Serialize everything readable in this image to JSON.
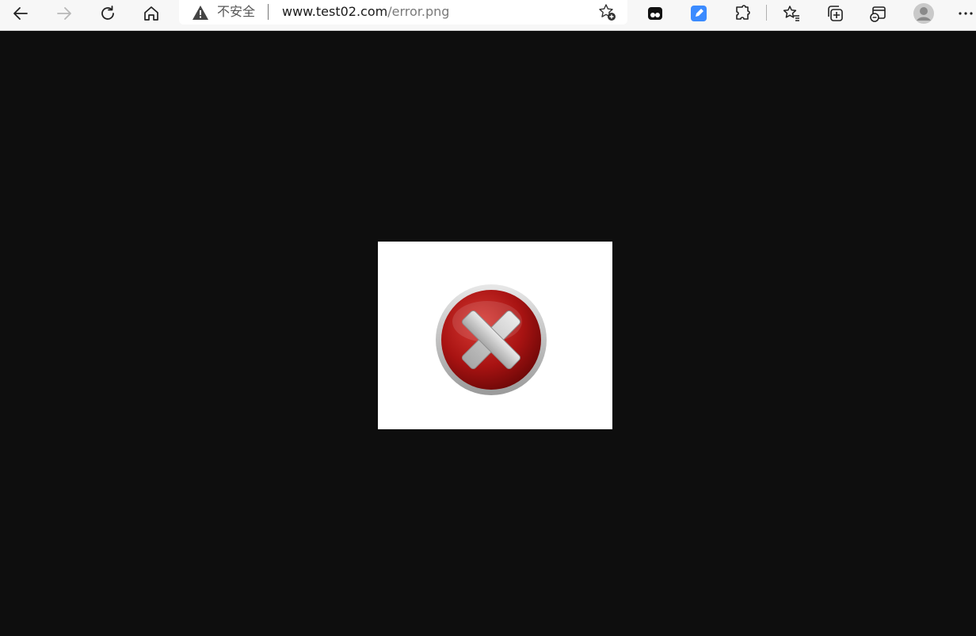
{
  "toolbar": {
    "security_label": "不安全",
    "url_host": "www.test02.com",
    "url_path": "/error.png"
  },
  "icons": {
    "back": "back-arrow-icon",
    "forward": "forward-arrow-icon",
    "refresh": "refresh-icon",
    "home": "home-icon",
    "warning": "warning-icon",
    "favorite_add": "add-favorite-icon",
    "extension1": "app-extension-icon",
    "extension2": "blue-extension-icon",
    "extensions": "puzzle-icon",
    "favorites": "favorites-icon",
    "collections": "collections-icon",
    "ie_mode": "ie-mode-icon",
    "profile": "profile-avatar-icon",
    "menu": "more-menu-icon"
  },
  "content": {
    "image": "error-x-icon",
    "background": "#0e0e0e"
  }
}
